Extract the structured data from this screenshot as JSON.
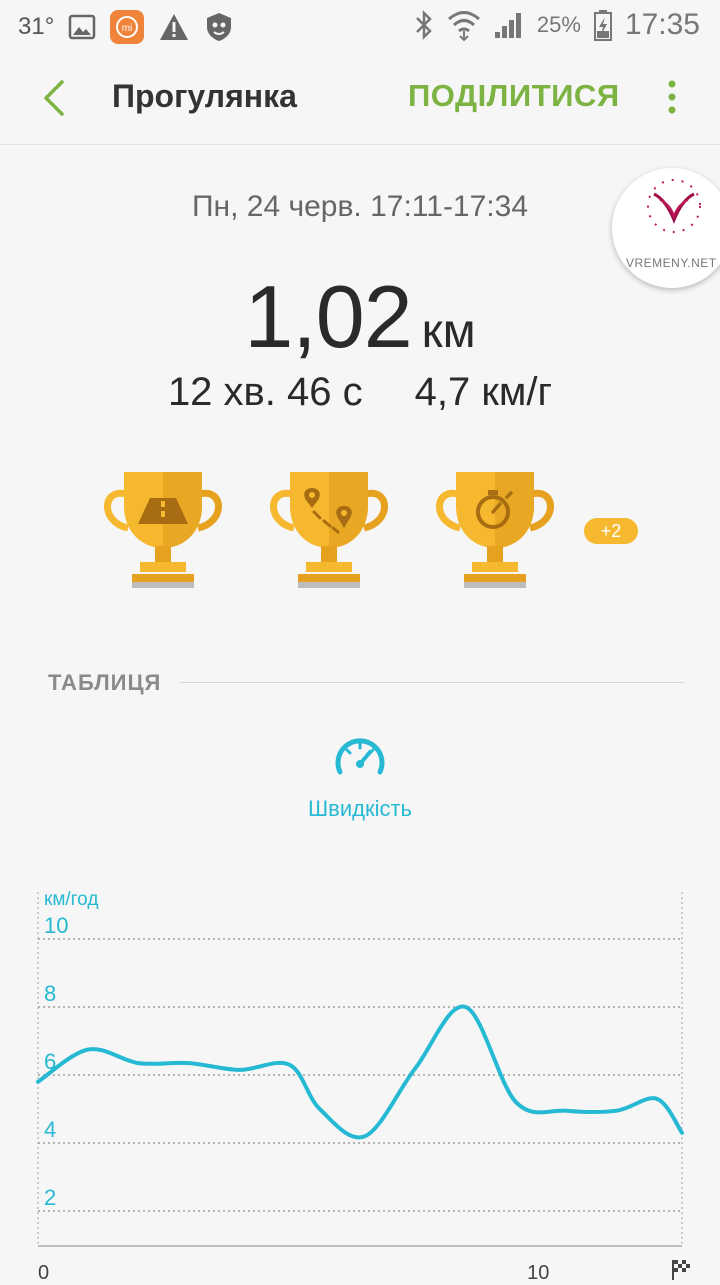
{
  "status_bar": {
    "temperature": "31°",
    "battery": "25%",
    "time": "17:35",
    "icons": [
      "gallery-icon",
      "mi-icon",
      "warning-icon",
      "shield-icon",
      "bluetooth-icon",
      "wifi-icon",
      "signal-icon",
      "battery-icon"
    ]
  },
  "app_bar": {
    "title": "Прогулянка",
    "share_label": "ПОДІЛИТИСЯ"
  },
  "watermark": {
    "text": "VREMENY.NET"
  },
  "summary": {
    "date_time": "Пн, 24 черв. 17:11-17:34",
    "distance": "1,02",
    "distance_unit": "км",
    "duration": "12 хв. 46 с",
    "pace": "4,7 км/г"
  },
  "achievements": {
    "trophies": [
      "road-trophy",
      "route-trophy",
      "stopwatch-trophy"
    ],
    "more_badge": "+2"
  },
  "section": {
    "title": "ТАБЛИЦЯ"
  },
  "metric_tab": {
    "label": "Швидкість"
  },
  "colors": {
    "accent_green": "#7cb342",
    "chart_cyan": "#26b9d3",
    "trophy_gold": "#f5b82e"
  },
  "chart_data": {
    "type": "line",
    "ylabel": "км/год",
    "ylim": [
      0,
      10
    ],
    "y_ticks": [
      10,
      8,
      6,
      4,
      2
    ],
    "x_ticks": [
      "0",
      "10"
    ],
    "xlim": [
      0,
      12.8
    ],
    "grid": true,
    "series": [
      {
        "x": [
          0,
          1,
          2,
          3,
          4,
          5,
          5.6,
          6.5,
          7.5,
          8.5,
          9.5,
          10.5,
          11.5,
          12.3,
          12.8
        ],
        "values": [
          5.8,
          6.75,
          6.35,
          6.35,
          6.15,
          6.3,
          5.0,
          4.2,
          6.2,
          8.0,
          5.2,
          4.95,
          4.95,
          5.3,
          4.3
        ]
      }
    ]
  }
}
